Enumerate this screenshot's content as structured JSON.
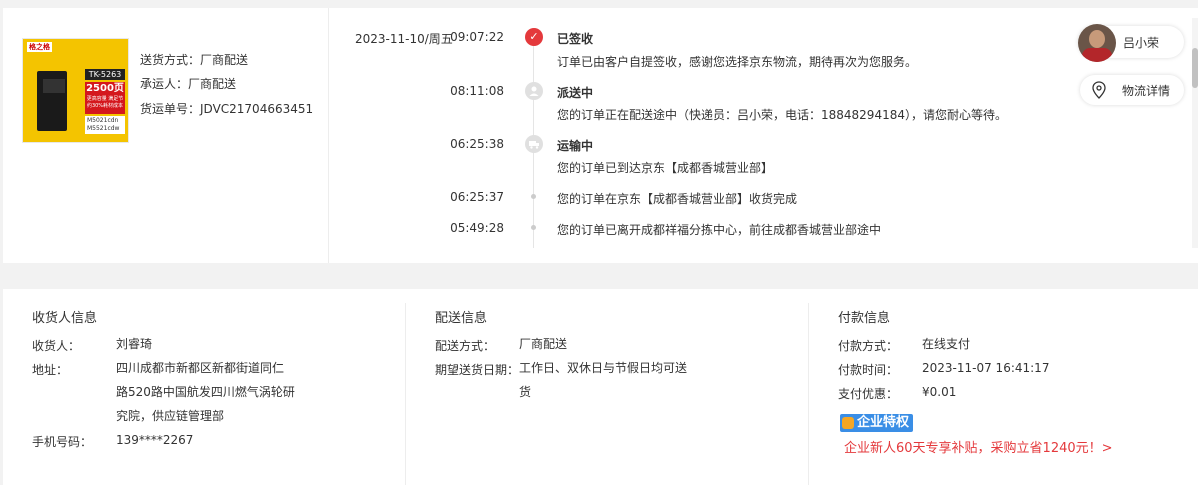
{
  "product": {
    "logo_text": "格之格",
    "model_tag": "TK-5263",
    "pages_big": "2500页",
    "pages_small": "更高容量 满足节约30%耗材成本",
    "model_lines": "M5021cdn M5521cdw"
  },
  "shipping": {
    "method": "送货方式：厂商配送",
    "carrier": "承运人：厂商配送",
    "tracking": "货运单号：JDVC21704663451"
  },
  "timeline": {
    "date": "2023-11-10/周五",
    "events": [
      {
        "time": "09:07:22",
        "title": "已签收",
        "text": "订单已由客户自提签收，感谢您选择京东物流，期待再次为您服务。"
      },
      {
        "time": "08:11:08",
        "title": "派送中",
        "text": "您的订单正在配送途中（快递员：吕小荣，电话：18848294184），请您耐心等待。"
      },
      {
        "time": "06:25:38",
        "title": "运输中",
        "text": "您的订单已到达京东【成都香城营业部】"
      },
      {
        "time": "06:25:37",
        "title": "",
        "text": "您的订单在京东【成都香城营业部】收货完成"
      },
      {
        "time": "05:49:28",
        "title": "",
        "text": "您的订单已离开成都祥福分拣中心，前往成都香城营业部途中"
      }
    ]
  },
  "courier": {
    "name": "吕小荣",
    "detail_label": "物流详情"
  },
  "consignee": {
    "section_title": "收货人信息",
    "name_label": "收货人：",
    "name": "刘睿琦",
    "address_label": "地址：",
    "address_lines": [
      "四川成都市新都区新都街道同仁",
      "路520路中国航发四川燃气涡轮研",
      "究院，供应链管理部"
    ],
    "phone_label": "手机号码：",
    "phone": "139****2267"
  },
  "delivery": {
    "section_title": "配送信息",
    "method_label": "配送方式：",
    "method": "厂商配送",
    "date_label": "期望送货日期：",
    "date_lines": [
      "工作日、双休日与节假日均可送",
      "货"
    ]
  },
  "payment": {
    "section_title": "付款信息",
    "method_label": "付款方式：",
    "method": "在线支付",
    "time_label": "付款时间：",
    "time": "2023-11-07 16:41:17",
    "discount_label": "支付优惠：",
    "discount": "¥0.01",
    "badge": "企业特权",
    "promo": "企业新人60天专享补贴，采购立省1240元！>"
  },
  "colors": {
    "accent_red": "#e4393c",
    "badge_blue": "#3a8ee6"
  }
}
